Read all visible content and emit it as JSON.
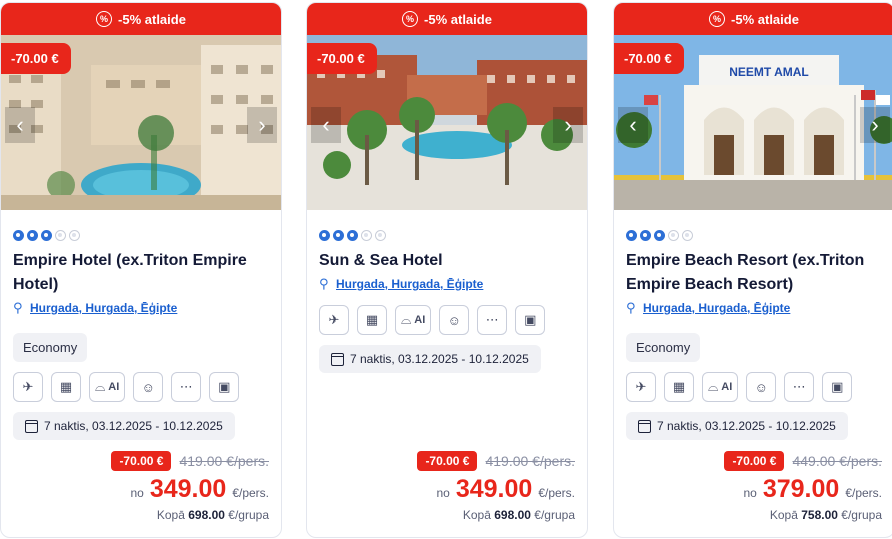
{
  "cards": [
    {
      "promo": "-5% atlaide",
      "promo_icon": "%",
      "discount_badge": "-70.00 €",
      "stars_filled": 3,
      "stars_total": 5,
      "name": "Empire Hotel (ex.Triton Empire Hotel)",
      "location": "Hurgada, Hurgada, Ēģipte",
      "board": "Economy",
      "amenity_ai": "AI",
      "dates": "7 naktis, 03.12.2025 - 10.12.2025",
      "price_discount": "-70.00 €",
      "old_price": "419.00 €/pers.",
      "price_prefix": "no",
      "price": "349.00",
      "price_unit": "€/pers.",
      "total_label": "Kopā",
      "total_value": "698.00",
      "total_unit": "€/grupa"
    },
    {
      "promo": "-5% atlaide",
      "promo_icon": "%",
      "discount_badge": "-70.00 €",
      "stars_filled": 3,
      "stars_total": 5,
      "name": "Sun & Sea Hotel",
      "location": "Hurgada, Hurgada, Ēģipte",
      "board": "",
      "amenity_ai": "AI",
      "dates": "7 naktis, 03.12.2025 - 10.12.2025",
      "price_discount": "-70.00 €",
      "old_price": "419.00 €/pers.",
      "price_prefix": "no",
      "price": "349.00",
      "price_unit": "€/pers.",
      "total_label": "Kopā",
      "total_value": "698.00",
      "total_unit": "€/grupa"
    },
    {
      "promo": "-5% atlaide",
      "promo_icon": "%",
      "discount_badge": "-70.00 €",
      "stars_filled": 3,
      "stars_total": 5,
      "name": "Empire Beach Resort (ex.Triton Empire Beach Resort)",
      "location": "Hurgada, Hurgada, Ēģipte",
      "board": "Economy",
      "amenity_ai": "AI",
      "dates": "7 naktis, 03.12.2025 - 10.12.2025",
      "price_discount": "-70.00 €",
      "old_price": "449.00 €/pers.",
      "price_prefix": "no",
      "price": "379.00",
      "price_unit": "€/pers.",
      "total_label": "Kopā",
      "total_value": "758.00",
      "total_unit": "€/grupa",
      "photo_sign": "NEEMT AMAL"
    }
  ],
  "icons": {
    "prev": "chevron-left-icon",
    "next": "chevron-right-icon",
    "flight": "airplane-icon",
    "hotel": "building-icon",
    "meal": "food-cloche-icon",
    "person": "person-icon",
    "more": "more-dots-icon",
    "transfer": "bus-icon",
    "pin": "map-pin-icon",
    "calendar": "calendar-icon"
  },
  "colors": {
    "accent_red": "#e8261b",
    "link_blue": "#1a5fcf",
    "star_blue": "#2d6fd6"
  }
}
